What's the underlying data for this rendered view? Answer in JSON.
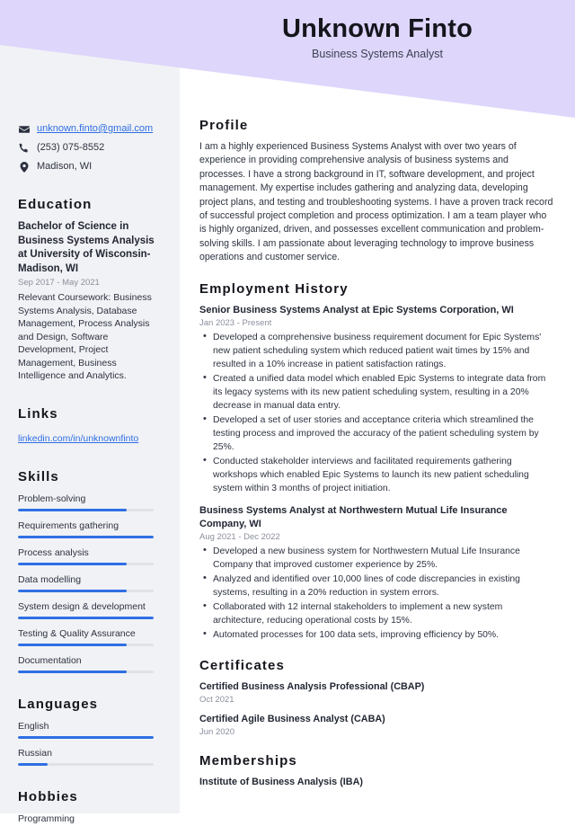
{
  "theme": {
    "accent": "#2f6fe4",
    "header_bg": "#ded6fb",
    "sidebar_bg": "#f1f2f5",
    "text": "#2d3240",
    "muted": "#8b8f9c"
  },
  "header": {
    "name": "Unknown Finto",
    "job_title": "Business Systems Analyst"
  },
  "sidebar": {
    "contacts": [
      {
        "icon": "envelope-icon",
        "value": "unknown.finto@gmail.com",
        "is_link": true
      },
      {
        "icon": "phone-icon",
        "value": "(253) 075-8552",
        "is_link": false
      },
      {
        "icon": "location-pin-icon",
        "value": "Madison, WI",
        "is_link": false
      }
    ],
    "education": {
      "heading": "Education",
      "degree": "Bachelor of Science in Business Systems Analysis at University of Wisconsin-Madison, WI",
      "date": "Sep 2017 - May 2021",
      "description": "Relevant Coursework: Business Systems Analysis, Database Management, Process Analysis and Design, Software Development, Project Management, Business Intelligence and Analytics."
    },
    "links": {
      "heading": "Links",
      "items": [
        "linkedin.com/in/unknownfinto"
      ]
    },
    "skills": {
      "heading": "Skills",
      "items": [
        {
          "label": "Problem-solving",
          "level": 80
        },
        {
          "label": "Requirements gathering",
          "level": 100
        },
        {
          "label": "Process analysis",
          "level": 80
        },
        {
          "label": "Data modelling",
          "level": 80
        },
        {
          "label": "System design & development",
          "level": 100
        },
        {
          "label": "Testing & Quality Assurance",
          "level": 80
        },
        {
          "label": "Documentation",
          "level": 80
        }
      ]
    },
    "languages": {
      "heading": "Languages",
      "items": [
        {
          "label": "English",
          "level": 100
        },
        {
          "label": "Russian",
          "level": 22
        }
      ]
    },
    "hobbies": {
      "heading": "Hobbies",
      "items": [
        "Programming"
      ]
    }
  },
  "main": {
    "profile": {
      "heading": "Profile",
      "text": "I am a highly experienced Business Systems Analyst with over two years of experience in providing comprehensive analysis of business systems and processes. I have a strong background in IT, software development, and project management. My expertise includes gathering and analyzing data, developing project plans, and testing and troubleshooting systems. I have a proven track record of successful project completion and process optimization. I am a team player who is highly organized, driven, and possesses excellent communication and problem-solving skills. I am passionate about leveraging technology to improve business operations and customer service."
    },
    "employment": {
      "heading": "Employment History",
      "jobs": [
        {
          "title": "Senior Business Systems Analyst at Epic Systems Corporation, WI",
          "date": "Jan 2023 - Present",
          "bullets": [
            "Developed a comprehensive business requirement document for Epic Systems' new patient scheduling system which reduced patient wait times by 15% and resulted in a 10% increase in patient satisfaction ratings.",
            "Created a unified data model which enabled Epic Systems to integrate data from its legacy systems with its new patient scheduling system, resulting in a 20% decrease in manual data entry.",
            "Developed a set of user stories and acceptance criteria which streamlined the testing process and improved the accuracy of the patient scheduling system by 25%.",
            "Conducted stakeholder interviews and facilitated requirements gathering workshops which enabled Epic Systems to launch its new patient scheduling system within 3 months of project initiation."
          ]
        },
        {
          "title": "Business Systems Analyst at Northwestern Mutual Life Insurance Company, WI",
          "date": "Aug 2021 - Dec 2022",
          "bullets": [
            "Developed a new business system for Northwestern Mutual Life Insurance Company that improved customer experience by 25%.",
            "Analyzed and identified over 10,000 lines of code discrepancies in existing systems, resulting in a 20% reduction in system errors.",
            "Collaborated with 12 internal stakeholders to implement a new system architecture, reducing operational costs by 15%.",
            "Automated processes for 100 data sets, improving efficiency by 50%."
          ]
        }
      ]
    },
    "certificates": {
      "heading": "Certificates",
      "items": [
        {
          "name": "Certified Business Analysis Professional (CBAP)",
          "date": "Oct 2021"
        },
        {
          "name": "Certified Agile Business Analyst (CABA)",
          "date": "Jun 2020"
        }
      ]
    },
    "memberships": {
      "heading": "Memberships",
      "items": [
        {
          "name": "Institute of Business Analysis (IBA)"
        }
      ]
    }
  }
}
